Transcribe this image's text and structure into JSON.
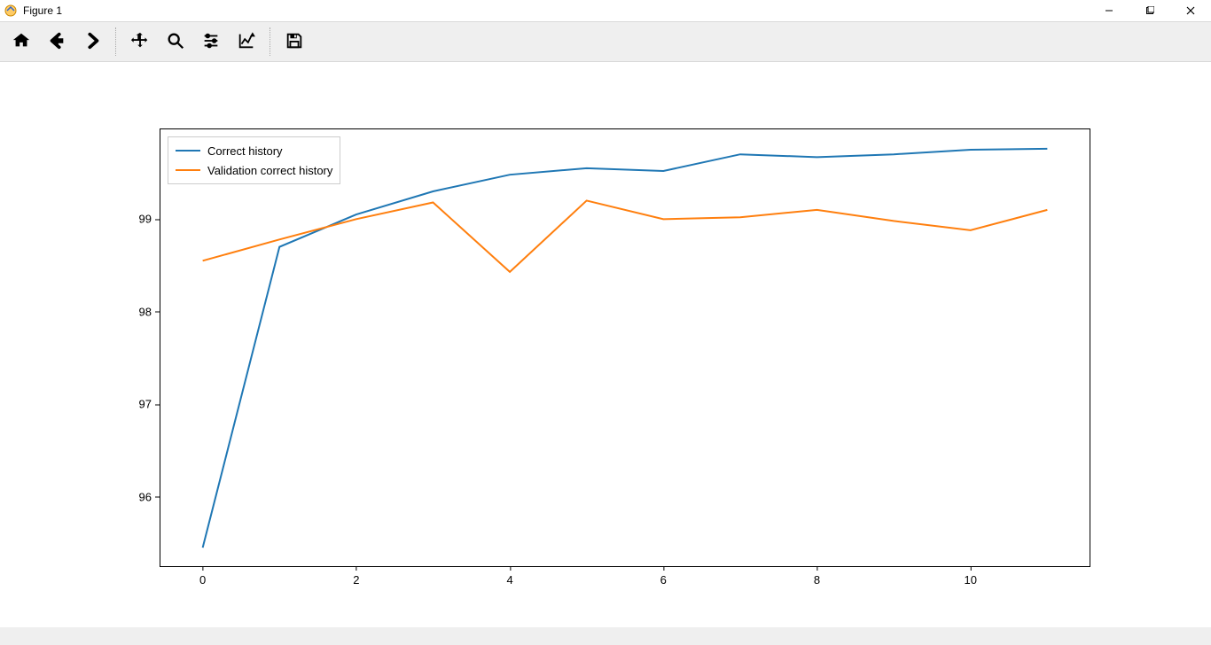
{
  "window": {
    "title": "Figure 1"
  },
  "toolbar": {
    "buttons": [
      {
        "name": "home-icon"
      },
      {
        "name": "back-icon"
      },
      {
        "name": "forward-icon"
      },
      {
        "sep": true
      },
      {
        "name": "pan-icon"
      },
      {
        "name": "zoom-icon"
      },
      {
        "name": "configure-icon"
      },
      {
        "name": "axes-edit-icon"
      },
      {
        "sep": true
      },
      {
        "name": "save-icon"
      }
    ]
  },
  "legend": {
    "items": [
      {
        "label": "Correct history",
        "color": "#1f77b4"
      },
      {
        "label": "Validation correct history",
        "color": "#ff7f0e"
      }
    ]
  },
  "chart_data": {
    "type": "line",
    "x": [
      0,
      1,
      2,
      3,
      4,
      5,
      6,
      7,
      8,
      9,
      10,
      11
    ],
    "series": [
      {
        "name": "Correct history",
        "color": "#1f77b4",
        "values": [
          95.45,
          98.7,
          99.05,
          99.3,
          99.48,
          99.55,
          99.52,
          99.7,
          99.67,
          99.7,
          99.75,
          99.76
        ]
      },
      {
        "name": "Validation correct history",
        "color": "#ff7f0e",
        "values": [
          98.55,
          98.78,
          99.0,
          99.18,
          98.43,
          99.2,
          99.0,
          99.02,
          99.1,
          98.98,
          98.88,
          99.1
        ]
      }
    ],
    "xlabel": "",
    "ylabel": "",
    "xlim": [
      -0.55,
      11.55
    ],
    "ylim": [
      95.25,
      99.97
    ],
    "xticks": [
      0,
      2,
      4,
      6,
      8,
      10
    ],
    "yticks": [
      96,
      97,
      98,
      99
    ]
  }
}
